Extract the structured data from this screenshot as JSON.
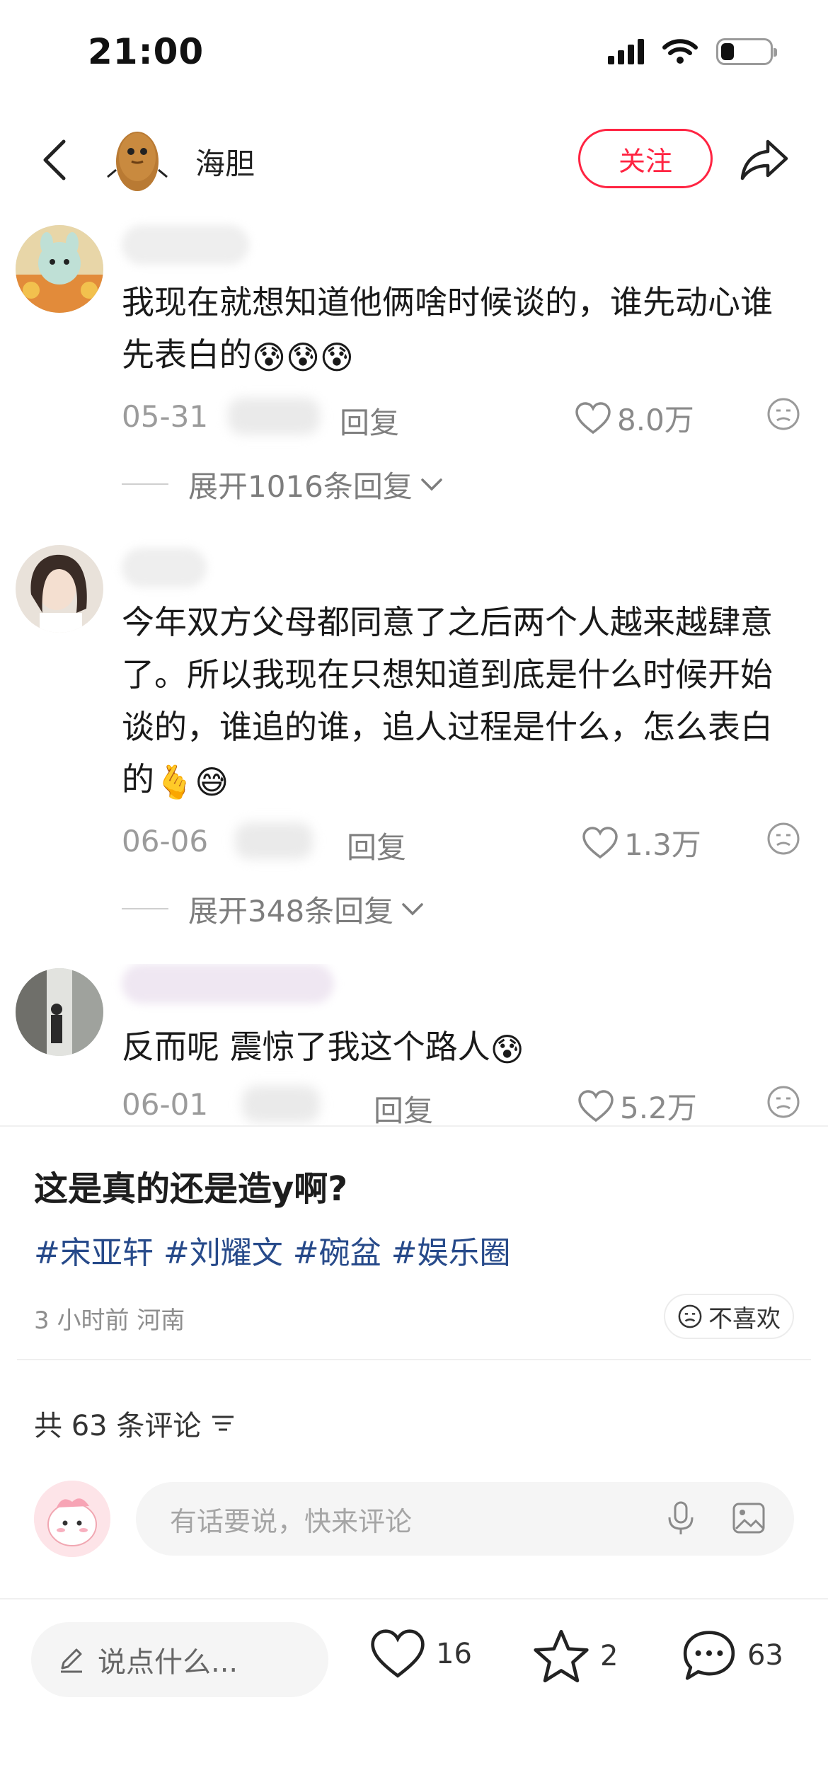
{
  "status_bar": {
    "time": "21:00"
  },
  "header": {
    "author_name": "海胆",
    "follow_label": "关注"
  },
  "comments": [
    {
      "text": "我现在就想知道他俩啥时候谈的，谁先动心谁先表白的",
      "emojis": "😰😰😰",
      "date": "05-31",
      "reply_label": "回复",
      "likes": "8.0万",
      "expand_label": "展开1016条回复"
    },
    {
      "text": "今年双方父母都同意了之后两个人越来越肆意了。所以我现在只想知道到底是什么时候开始谈的，谁追的谁，追人过程是什么，怎么表白的",
      "emojis": "🫰😅",
      "date": "06-06",
      "reply_label": "回复",
      "likes": "1.3万",
      "expand_label": "展开348条回复"
    },
    {
      "text": "反而呢 震惊了我这个路人",
      "emojis": "😰",
      "date": "06-01",
      "reply_label": "回复",
      "likes": "5.2万"
    }
  ],
  "note": {
    "title": "这是真的还是造y啊?",
    "tags": [
      "#宋亚轩",
      "#刘耀文",
      "#碗盆",
      "#娱乐圈"
    ],
    "meta": "3 小时前  河南",
    "dislike_label": "不喜欢",
    "comment_count_label": "共 63 条评论"
  },
  "comment_input": {
    "placeholder": "有话要说，快来评论"
  },
  "bottom_bar": {
    "say_placeholder": "说点什么...",
    "like_count": "16",
    "collect_count": "2",
    "comment_count": "63"
  },
  "colors": {
    "accent": "#ff2442",
    "tag": "#274a8a"
  }
}
